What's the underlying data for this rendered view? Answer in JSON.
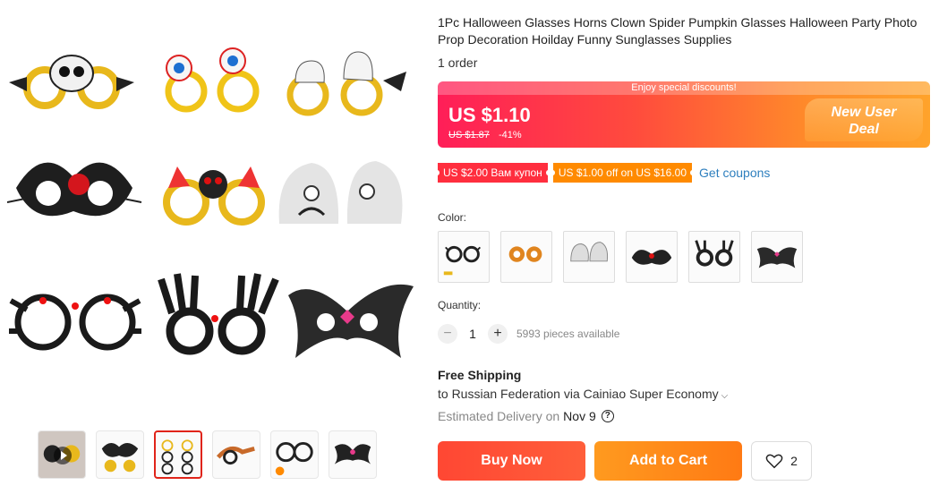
{
  "product": {
    "title": "1Pc Halloween Glasses Horns Clown Spider Pumpkin Glasses Halloween Party Photo Prop Decoration Hoilday Funny Sunglasses Supplies",
    "orders": "1 order"
  },
  "price": {
    "discount_banner": "Enjoy special discounts!",
    "current": "US $1.10",
    "original": "US $1.87",
    "discount_pct": "-41%",
    "new_user_line1": "New User",
    "new_user_line2": "Deal"
  },
  "coupons": {
    "items": [
      "US $2.00 Вам купон",
      "US $1.00 off on US $16.00"
    ],
    "get_coupons": "Get coupons"
  },
  "options": {
    "color_label": "Color:",
    "quantity_label": "Quantity:",
    "quantity_value": "1",
    "minus": "−",
    "plus": "+",
    "available": "5993 pieces available"
  },
  "shipping": {
    "title": "Free Shipping",
    "destination": "to Russian Federation via Cainiao Super Economy",
    "estimated_label": "Estimated Delivery on",
    "estimated_date": "Nov 9",
    "help": "?"
  },
  "actions": {
    "buy_now": "Buy Now",
    "add_to_cart": "Add to Cart",
    "wishlist_count": "2"
  },
  "colors": {
    "accent_red": "#ff4733",
    "accent_orange": "#ff8a00",
    "link_blue": "#2e7fbe"
  }
}
